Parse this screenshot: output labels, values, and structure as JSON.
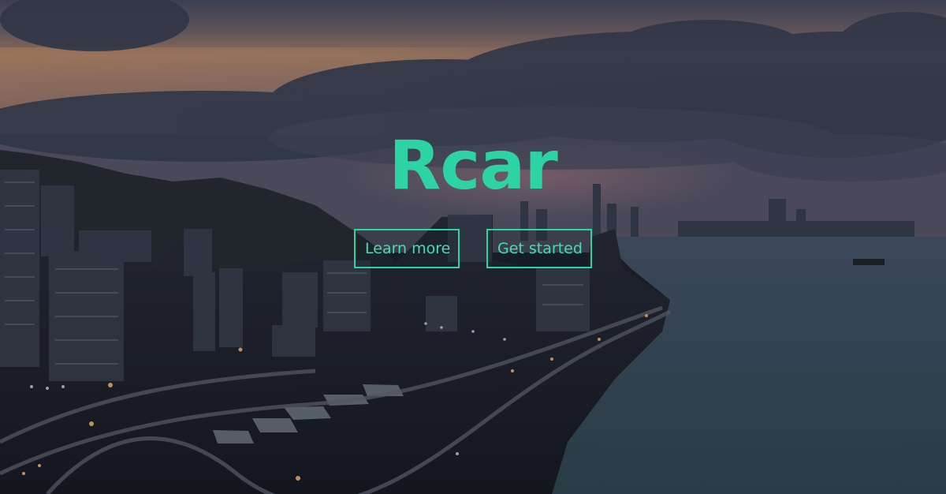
{
  "hero": {
    "brand": "Rcar",
    "buttons": {
      "learn_more": "Learn more",
      "get_started": "Get started"
    }
  },
  "colors": {
    "accent": "#2ed3a4",
    "button_border": "#2ed3a4",
    "button_text": "#3fe0b0",
    "overlay": "#141824"
  },
  "icons": {
    "background": "city-skyline-photo"
  }
}
